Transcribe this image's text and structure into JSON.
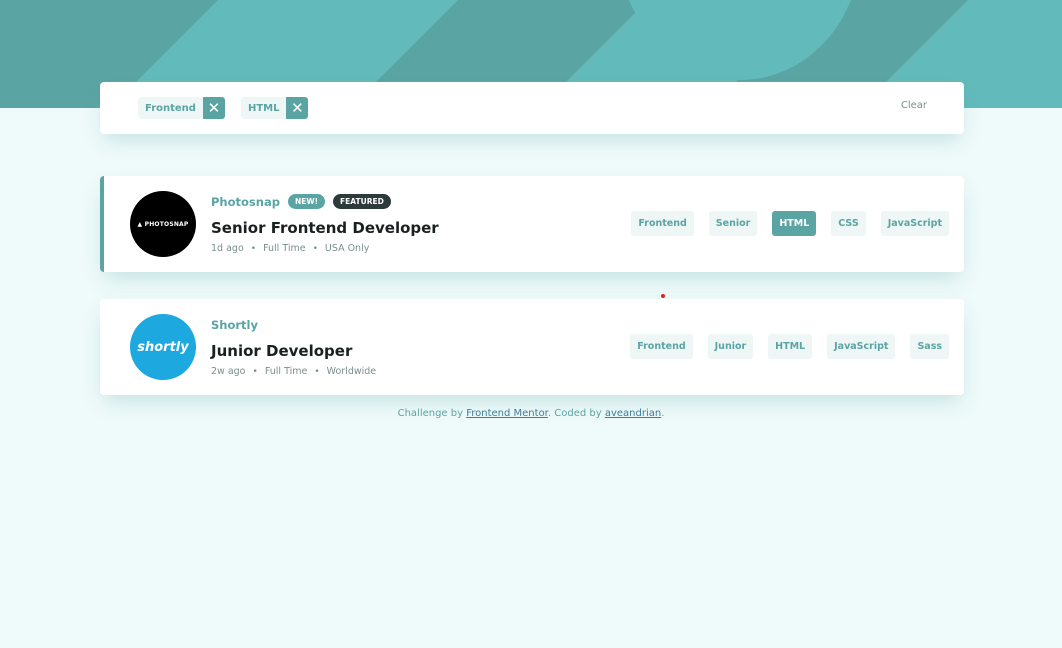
{
  "filters": [
    {
      "label": "Frontend"
    },
    {
      "label": "HTML"
    }
  ],
  "remove_glyph": "✕",
  "clear_label": "Clear",
  "jobs": [
    {
      "company": "Photosnap",
      "logo_text": "▲ PHOTOSNAP",
      "badge_new": "NEW!",
      "badge_featured": "FEATURED",
      "position": "Senior Frontend Developer",
      "posted": "1d ago",
      "contract": "Full Time",
      "location": "USA Only",
      "tags": [
        "Frontend",
        "Senior",
        "HTML",
        "CSS",
        "JavaScript"
      ]
    },
    {
      "company": "Shortly",
      "logo_text": "shortly",
      "position": "Junior Developer",
      "posted": "2w ago",
      "contract": "Full Time",
      "location": "Worldwide",
      "tags": [
        "Frontend",
        "Junior",
        "HTML",
        "JavaScript",
        "Sass"
      ]
    }
  ],
  "meta_separator": "•",
  "attribution": {
    "prefix": "Challenge by ",
    "link1": "Frontend Mentor",
    "middle": ". Coded by ",
    "link2": "aveandrian",
    "suffix": "."
  },
  "colors": {
    "primary": "#5ba4a4",
    "background": "#effafa",
    "dark_badge": "#2c3a3a",
    "shortly_logo": "#1ea8e0"
  }
}
